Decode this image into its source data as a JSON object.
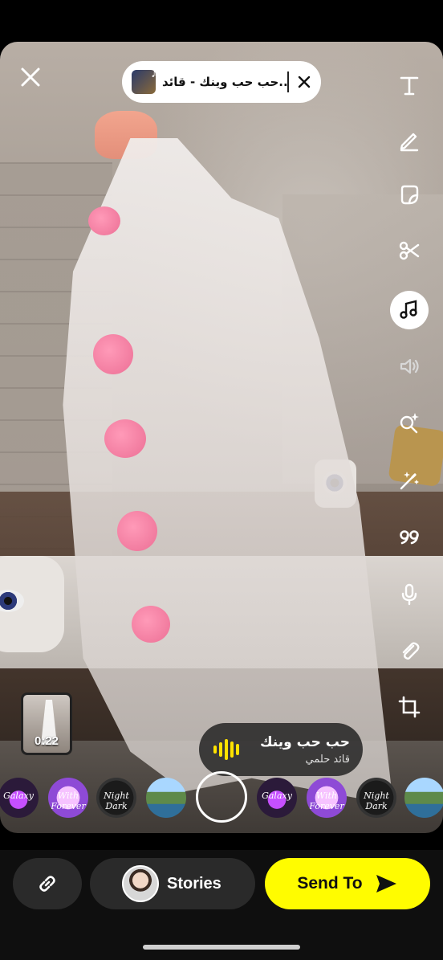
{
  "music_sticker": {
    "title": "حب حب وينك - قائد...",
    "close_icon": "close-icon"
  },
  "toolbar": {
    "tools": [
      {
        "name": "text",
        "icon": "text-icon"
      },
      {
        "name": "draw",
        "icon": "pencil-icon"
      },
      {
        "name": "sticker",
        "icon": "sticker-icon"
      },
      {
        "name": "scissors",
        "icon": "scissors-icon"
      },
      {
        "name": "music",
        "icon": "music-note-icon",
        "active": true
      },
      {
        "name": "sound",
        "icon": "speaker-icon"
      },
      {
        "name": "lens",
        "icon": "magnifier-sparkle-icon"
      },
      {
        "name": "magic",
        "icon": "magic-wand-icon"
      },
      {
        "name": "quote",
        "icon": "quote-icon"
      },
      {
        "name": "voice",
        "icon": "microphone-icon"
      },
      {
        "name": "attach",
        "icon": "paperclip-icon"
      },
      {
        "name": "crop",
        "icon": "crop-icon"
      }
    ]
  },
  "clip": {
    "duration": "0:22"
  },
  "now_playing": {
    "title": "حب حب وينك",
    "artist": "قائد حلمي"
  },
  "lenses": [
    {
      "name": "purple-lens",
      "label": "Galaxy"
    },
    {
      "name": "forever-lens",
      "label": "With Forever"
    },
    {
      "name": "script-lens",
      "label": "Night Dark"
    },
    {
      "name": "landscape-lens",
      "label": ""
    },
    {
      "name": "purple-lens",
      "label": "Galaxy"
    },
    {
      "name": "forever-lens",
      "label": "With Forever"
    },
    {
      "name": "script-lens",
      "label": "Night Dark"
    },
    {
      "name": "landscape-lens",
      "label": ""
    }
  ],
  "bottom_bar": {
    "stories_label": "Stories",
    "send_label": "Send To"
  },
  "colors": {
    "send_button": "#fffc00",
    "wave": "#ffe200",
    "dark_button": "#2a2a2a"
  }
}
